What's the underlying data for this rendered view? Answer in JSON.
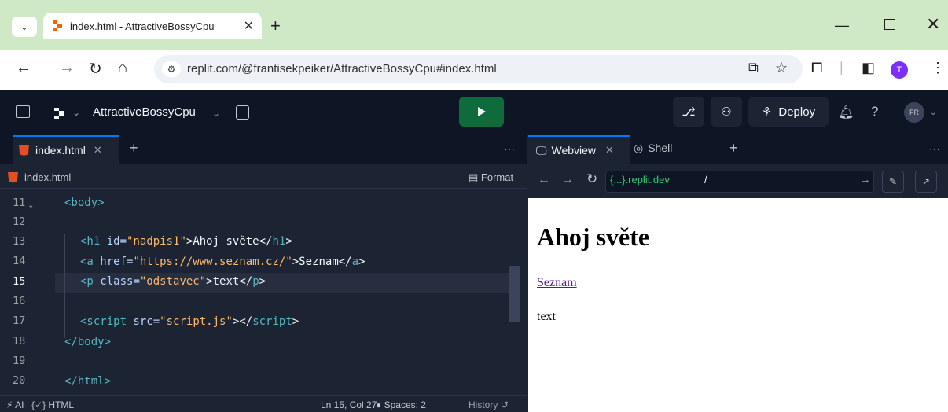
{
  "browser": {
    "tab_title": "index.html - AttractiveBossyCpu",
    "url": "replit.com/@frantisekpeiker/AttractiveBossyCpu#index.html",
    "profile_initial": "T"
  },
  "replit": {
    "project_name": "AttractiveBossyCpu",
    "deploy_label": "Deploy",
    "user_initials": "FR"
  },
  "editor": {
    "tab_label": "index.html",
    "breadcrumb": "index.html",
    "format_label": "Format",
    "lines": [
      {
        "num": "11"
      },
      {
        "num": "12"
      },
      {
        "num": "13"
      },
      {
        "num": "14"
      },
      {
        "num": "15"
      },
      {
        "num": "16"
      },
      {
        "num": "17"
      },
      {
        "num": "18"
      },
      {
        "num": "19"
      },
      {
        "num": "20"
      }
    ],
    "code": {
      "l11_tag": "<body>",
      "l13_open": "<h1",
      "l13_attr": "id=",
      "l13_val": "\"nadpis1\"",
      "l13_text": ">Ahoj světe</",
      "l13_close": "h1",
      "l14_open": "<a",
      "l14_attr": "href=",
      "l14_val": "\"https://www.seznam.cz/\"",
      "l14_text": ">Seznam</",
      "l14_close": "a",
      "l15_open": "<p",
      "l15_attr": "class=",
      "l15_val": "\"odstavec\"",
      "l15_text": ">text</",
      "l15_close": "p",
      "l17_open": "<script",
      "l17_attr": "src=",
      "l17_val": "\"script.js\"",
      "l17_mid": "></",
      "l17_close": "script",
      "l18": "</body>",
      "l20": "</html>"
    },
    "status": {
      "ai": "AI",
      "language": "HTML",
      "position": "Ln 15, Col 27",
      "spaces": "Spaces: 2",
      "history": "History"
    }
  },
  "webview": {
    "tab_webview": "Webview",
    "tab_shell": "Shell",
    "domain": "{...}.replit.dev",
    "path": "/",
    "heading": "Ahoj světe",
    "link_text": "Seznam",
    "paragraph": "text"
  },
  "colors": {
    "run_button": "#0f6b3b",
    "accent": "#0079f2",
    "editor_bg": "#1c2333",
    "header_bg": "#0e1525"
  }
}
